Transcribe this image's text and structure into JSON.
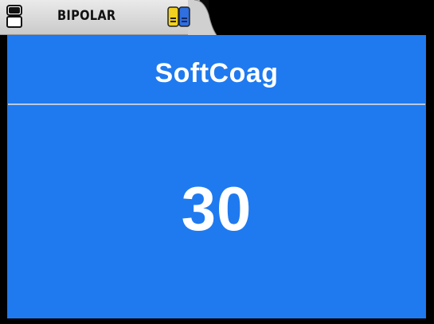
{
  "header": {
    "mode_label": "BIPOLAR",
    "instrument_icon": "instrument-slot-icon",
    "plug_icon": "dual-electrode-plug-icon"
  },
  "main": {
    "title": "SoftCoag",
    "value": "30"
  },
  "colors": {
    "panel_blue": "#1f7af0",
    "tab_gray": "#d8d8d8",
    "plug_yellow": "#f0d020",
    "plug_blue": "#2f6fe0",
    "background": "#000000"
  }
}
